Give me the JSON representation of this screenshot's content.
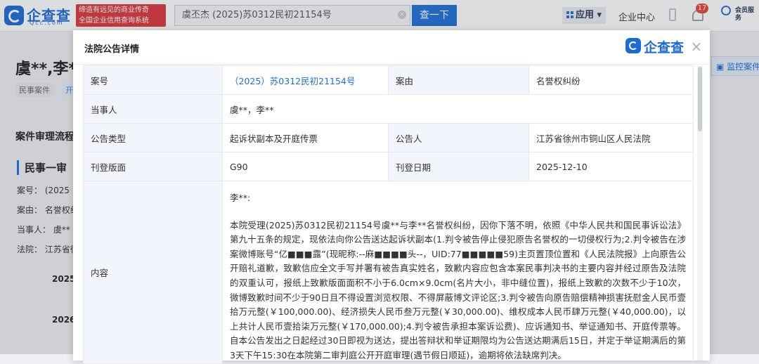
{
  "topbar": {
    "logo_text": "企查查",
    "logo_sub": "Qcc.com",
    "promo_line1": "缔造有远见的商业传奇",
    "promo_line2": "全国企业信用查询系统",
    "search_value": "虞丕杰 (2025)苏0312民初21154号",
    "search_button": "查一下",
    "app_menu": "应用",
    "enterprise_center": "企业中心",
    "notification_count": "17",
    "vip_label": "会员服务"
  },
  "background_page": {
    "title": "虞**,李**",
    "tag_civil": "民事案件",
    "tag_second": "开",
    "monitor_button": "监控案件",
    "section_title": "案件审理流程",
    "first_instance": "民事一审",
    "lines": [
      "案号： (2025",
      "案由： 名誉权纠",
      "当事人： 虞**",
      "法院： 江苏省徐"
    ],
    "years": [
      "2025",
      "2026"
    ]
  },
  "modal": {
    "title": "法院公告详情",
    "brand": "企查查",
    "close_symbol": "×",
    "rows": {
      "case_no_label": "案号",
      "case_no_value": "（2025）苏0312民初21154号",
      "cause_label": "案由",
      "cause_value": "名誉权纠纷",
      "party_label": "当事人",
      "party_value": "虞**，李**",
      "type_label": "公告类型",
      "type_value": "起诉状副本及开庭传票",
      "announcer_label": "公告人",
      "announcer_value": "江苏省徐州市铜山区人民法院",
      "page_label": "刊登版面",
      "page_value": "G90",
      "date_label": "刊登日期",
      "date_value": "2025-12-10",
      "content_label": "内容",
      "content_addressee": "李**:",
      "content_body": "本院受理(2025)苏0312民初21154号虞**与李**名誉权纠纷，因你下落不明，依照《中华人民共和国民事诉讼法》第九十五条的规定，现依法向你公告送达起诉状副本(1.判令被告停止侵犯原告名誉权的一切侵权行为;2.判令被告在涉案微博账号“亿■■■露”(现昵称:--麻■■■■头--，UID:77■■■■■59)主页置顶位置和《人民法院报》上向原告公开赔礼道歉，致歉信应全文手写并署有被告真实姓名，致歉内容应包含本案民事判决书的主要内容并经过原告及法院的双重认可，报纸上致歉版面面积不小于6.0cm×9.0cm(名片大小，非中缝位置)，报纸上致歉的次数不少于10次，微博致歉时间不少于90日且不得设置浏览权限、不得屏蔽博文评论区;3.判令被告向原告赔偿精神损害抚慰金人民币壹拾万元整(￥100,000.00)、经济损失人民币叁万元整(￥30,000.00)、维权成本人民币肆万元整(￥40,000.00)，以上共计人民币壹拾柒万元整(￥170,000.00);4.判令被告承担本案诉讼费)、应诉通知书、举证通知书、开庭传票等。自本公告发出之日起经过30日即视为送达，提出答辩状和举证期限均为公告送达期满后15日，并定于举证期满后的第3天下午15:30在本院第二审判庭公开开庭审理(遇节假日顺延)，逾期将依法缺席判决。"
    }
  },
  "colors": {
    "brand_blue": "#1d6cd6",
    "label_bg": "#f2f6fc",
    "promo_red": "#d9363e",
    "link_blue": "#1f6fd8"
  }
}
